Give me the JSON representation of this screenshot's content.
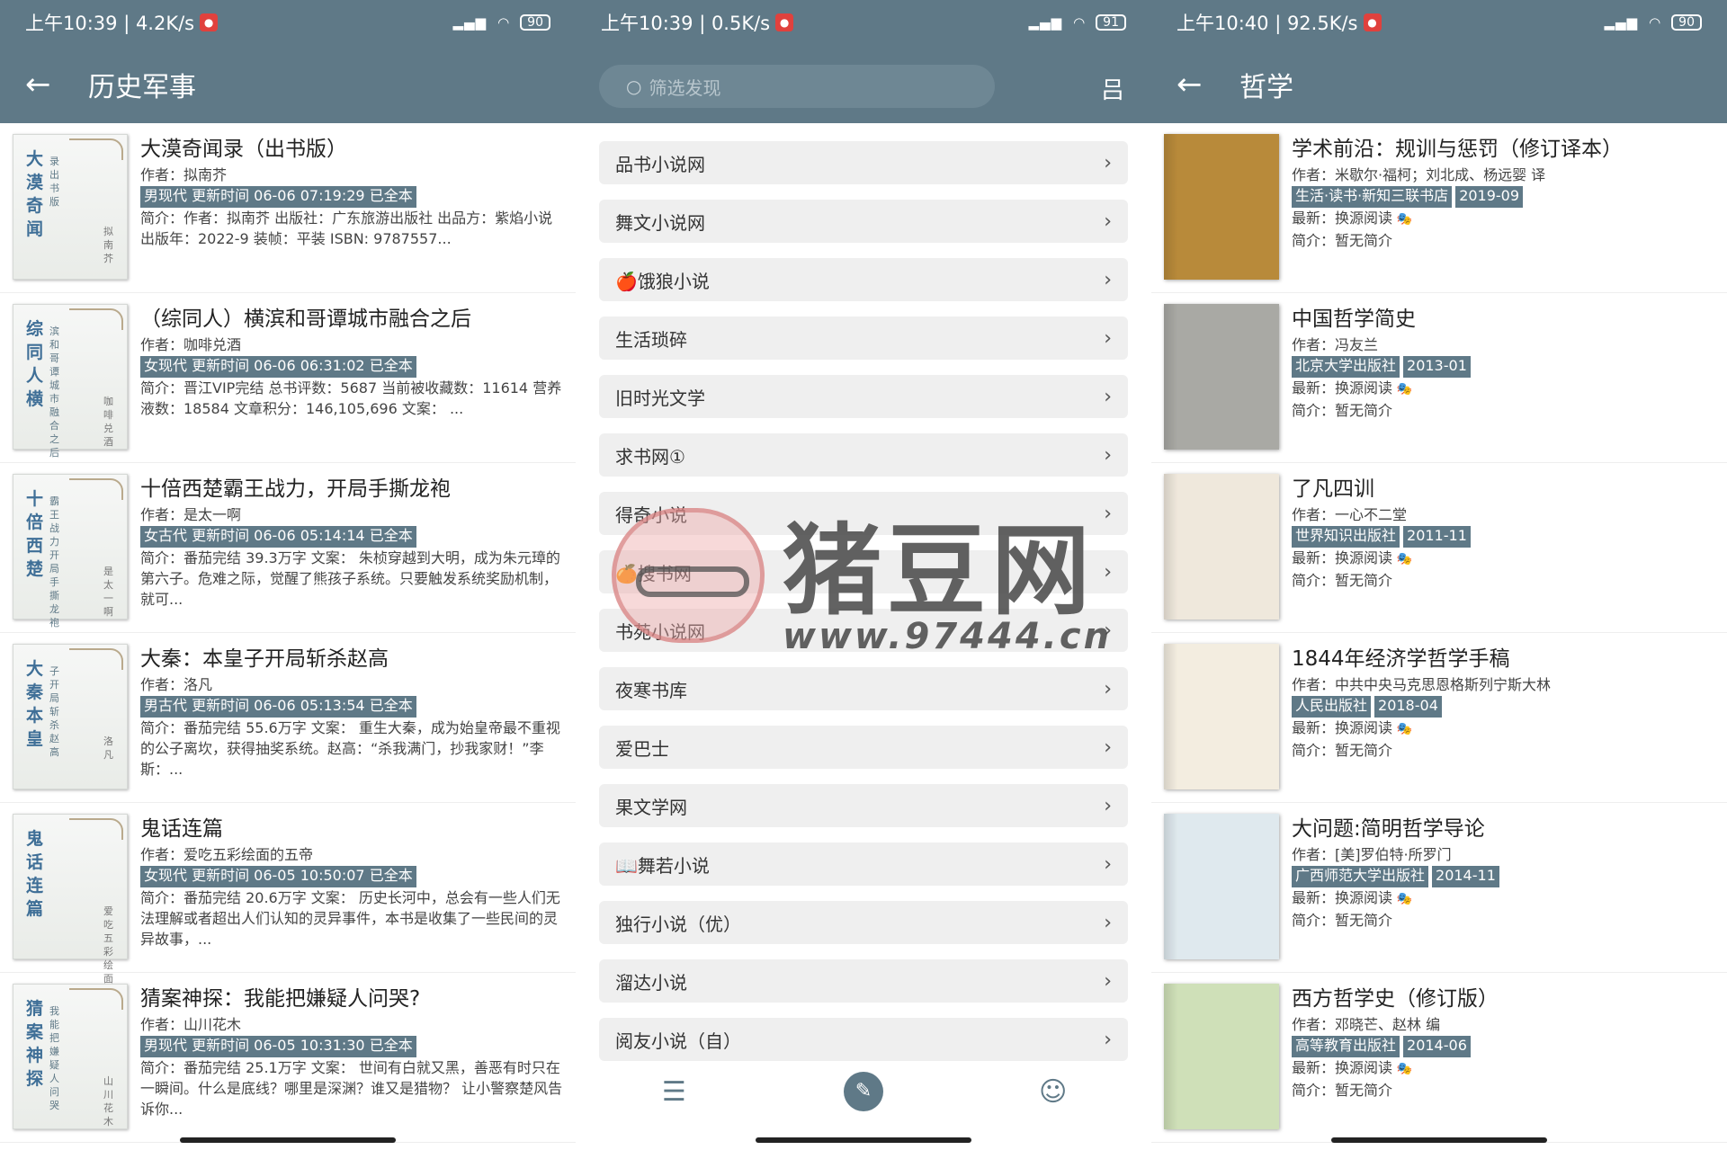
{
  "left": {
    "status": {
      "time": "上午10:39 | 4.2K/s",
      "battery": "90"
    },
    "title": "历史军事",
    "items": [
      {
        "title": "大漠奇闻录（出书版）",
        "author": "作者：拟南芥",
        "tag": "男现代 更新时间 06-06 07:19:29 已全本",
        "intro": "简介：作者：拟南芥 出版社：广东旅游出版社 出品方：紫焰小说 出版年：2022-9 装帧：平装 ISBN: 9787557...",
        "cv_big": "大漠奇闻",
        "cv_small": "录出书版",
        "cv_auth": "拟南芥"
      },
      {
        "title": "（综同人）横滨和哥谭城市融合之后",
        "author": "作者：咖啡兑酒",
        "tag": "女现代 更新时间 06-06 06:31:02 已全本",
        "intro": "简介：晋江VIP完结 总书评数：5687 当前被收藏数：11614 营养液数：18584 文章积分：146,105,696 文案： ...",
        "cv_big": "综同人横",
        "cv_small": "滨和哥谭城市融合之后",
        "cv_auth": "咖啡兑酒"
      },
      {
        "title": "十倍西楚霸王战力，开局手撕龙袍",
        "author": "作者：是太一啊",
        "tag": "女古代 更新时间 06-06 05:14:14 已全本",
        "intro": "简介：番茄完结 39.3万字 文案： 朱桢穿越到大明，成为朱元璋的第六子。危难之际，觉醒了熊孩子系统。只要触发系统奖励机制，就可...",
        "cv_big": "十倍西楚",
        "cv_small": "霸王战力开局手撕龙袍",
        "cv_auth": "是太一啊"
      },
      {
        "title": "大秦：本皇子开局斩杀赵高",
        "author": "作者：洛凡",
        "tag": "男古代 更新时间 06-06 05:13:54 已全本",
        "intro": "简介：番茄完结 55.6万字 文案： 重生大秦，成为始皇帝最不重视的公子离坎，获得抽奖系统。赵高：“杀我满门，抄我家财！”李斯：...",
        "cv_big": "大秦本皇",
        "cv_small": "子开局斩杀赵高",
        "cv_auth": "洛凡"
      },
      {
        "title": "鬼话连篇",
        "author": "作者：爱吃五彩绘面的五帝",
        "tag": "女现代 更新时间 06-05 10:50:07 已全本",
        "intro": "简介：番茄完结 20.6万字 文案： 历史长河中，总会有一些人们无法理解或者超出人们认知的灵异事件，本书是收集了一些民间的灵异故事，...",
        "cv_big": "鬼话连篇",
        "cv_small": "",
        "cv_auth": "爱吃五彩绘面的"
      },
      {
        "title": "猜案神探：我能把嫌疑人问哭?",
        "author": "作者：山川花木",
        "tag": "男现代 更新时间 06-05 10:31:30 已全本",
        "intro": "简介：番茄完结 25.1万字 文案： 世间有白就又黑，善恶有时只在一瞬间。什么是底线？哪里是深渊？谁又是猎物？ 让小警察楚风告诉你...",
        "cv_big": "猜案神探",
        "cv_small": "我能把嫌疑人问哭",
        "cv_auth": "山川花木"
      }
    ]
  },
  "middle": {
    "status": {
      "time": "上午10:39 | 0.5K/s",
      "battery": "91"
    },
    "search_placeholder": "筛选发现",
    "sources": [
      "品书小说网",
      "舞文小说网",
      "🍎饿狼小说",
      "生活琐碎",
      "旧时光文学",
      "求书网①",
      "得奇小说",
      "🍊搜书网",
      "书苑小说网",
      "夜寒书库",
      "爱巴士",
      "果文学网",
      "📖舞若小说",
      "独行小说（优）",
      "溜达小说",
      "阅友小说（自）"
    ]
  },
  "right": {
    "status": {
      "time": "上午10:40 | 92.5K/s",
      "battery": "90"
    },
    "title": "哲学",
    "items": [
      {
        "title": "学术前沿：规训与惩罚（修订译本）",
        "author": "作者：米歇尔·福柯；刘北成、杨远婴 译",
        "tags": [
          "生活·读书·新知三联书店",
          "2019-09"
        ],
        "latest": "最新：换源阅读",
        "intro": "简介：暂无简介",
        "color": "#b88a3a"
      },
      {
        "title": "中国哲学简史",
        "author": "作者：冯友兰",
        "tags": [
          "北京大学出版社",
          "2013-01"
        ],
        "latest": "最新：换源阅读",
        "intro": "简介：暂无简介",
        "color": "#a9a9a4"
      },
      {
        "title": "了凡四训",
        "author": "作者：一心不二堂",
        "tags": [
          "世界知识出版社",
          "2011-11"
        ],
        "latest": "最新：换源阅读",
        "intro": "简介：暂无简介",
        "color": "#efe8dc"
      },
      {
        "title": "1844年经济学哲学手稿",
        "author": "作者：中共中央马克思恩格斯列宁斯大林",
        "tags": [
          "人民出版社",
          "2018-04"
        ],
        "latest": "最新：换源阅读",
        "intro": "简介：暂无简介",
        "color": "#f3ede0"
      },
      {
        "title": "大问题:简明哲学导论",
        "author": "作者：[美]罗伯特·所罗门",
        "tags": [
          "广西师范大学出版社",
          "2014-11"
        ],
        "latest": "最新：换源阅读",
        "intro": "简介：暂无简介",
        "color": "#dfe9ee"
      },
      {
        "title": "西方哲学史（修订版）",
        "author": "作者：邓晓芒、赵林 编",
        "tags": [
          "高等教育出版社",
          "2014-06"
        ],
        "latest": "最新：换源阅读",
        "intro": "简介：暂无简介",
        "color": "#cfe0b8"
      }
    ]
  },
  "watermark": {
    "title": "猪豆网",
    "url": "www.97444.cn"
  }
}
